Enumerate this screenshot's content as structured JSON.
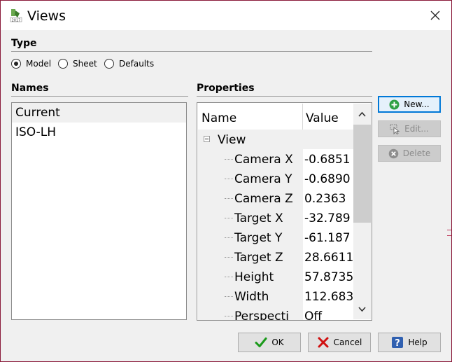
{
  "window": {
    "title": "Views"
  },
  "type_section": {
    "label": "Type",
    "options": [
      {
        "label": "Model",
        "checked": true
      },
      {
        "label": "Sheet",
        "checked": false
      },
      {
        "label": "Defaults",
        "checked": false
      }
    ]
  },
  "names_section": {
    "label": "Names",
    "items": [
      "Current",
      "ISO-LH"
    ],
    "selected_index": 0
  },
  "properties_section": {
    "label": "Properties",
    "columns": [
      "Name",
      "Value"
    ],
    "group": "View",
    "rows": [
      {
        "name": "Camera X",
        "value": "-0.6851"
      },
      {
        "name": "Camera Y",
        "value": "-0.6890"
      },
      {
        "name": "Camera Z",
        "value": "0.2363"
      },
      {
        "name": "Target X",
        "value": "-32.789"
      },
      {
        "name": "Target Y",
        "value": "-61.187"
      },
      {
        "name": "Target Z",
        "value": "28.6611"
      },
      {
        "name": "Height",
        "value": "57.8735"
      },
      {
        "name": "Width",
        "value": "112.683"
      },
      {
        "name": "Perspecti",
        "value": "Off"
      }
    ]
  },
  "side_buttons": {
    "new": "New...",
    "edit": "Edit...",
    "delete": "Delete"
  },
  "bottom_buttons": {
    "ok": "OK",
    "cancel": "Cancel",
    "help": "Help"
  },
  "colors": {
    "accent": "#0078d7",
    "ok_check": "#1a9a1a",
    "cancel_x": "#d01010",
    "help_blue": "#3060b0",
    "new_green": "#2ea043"
  }
}
